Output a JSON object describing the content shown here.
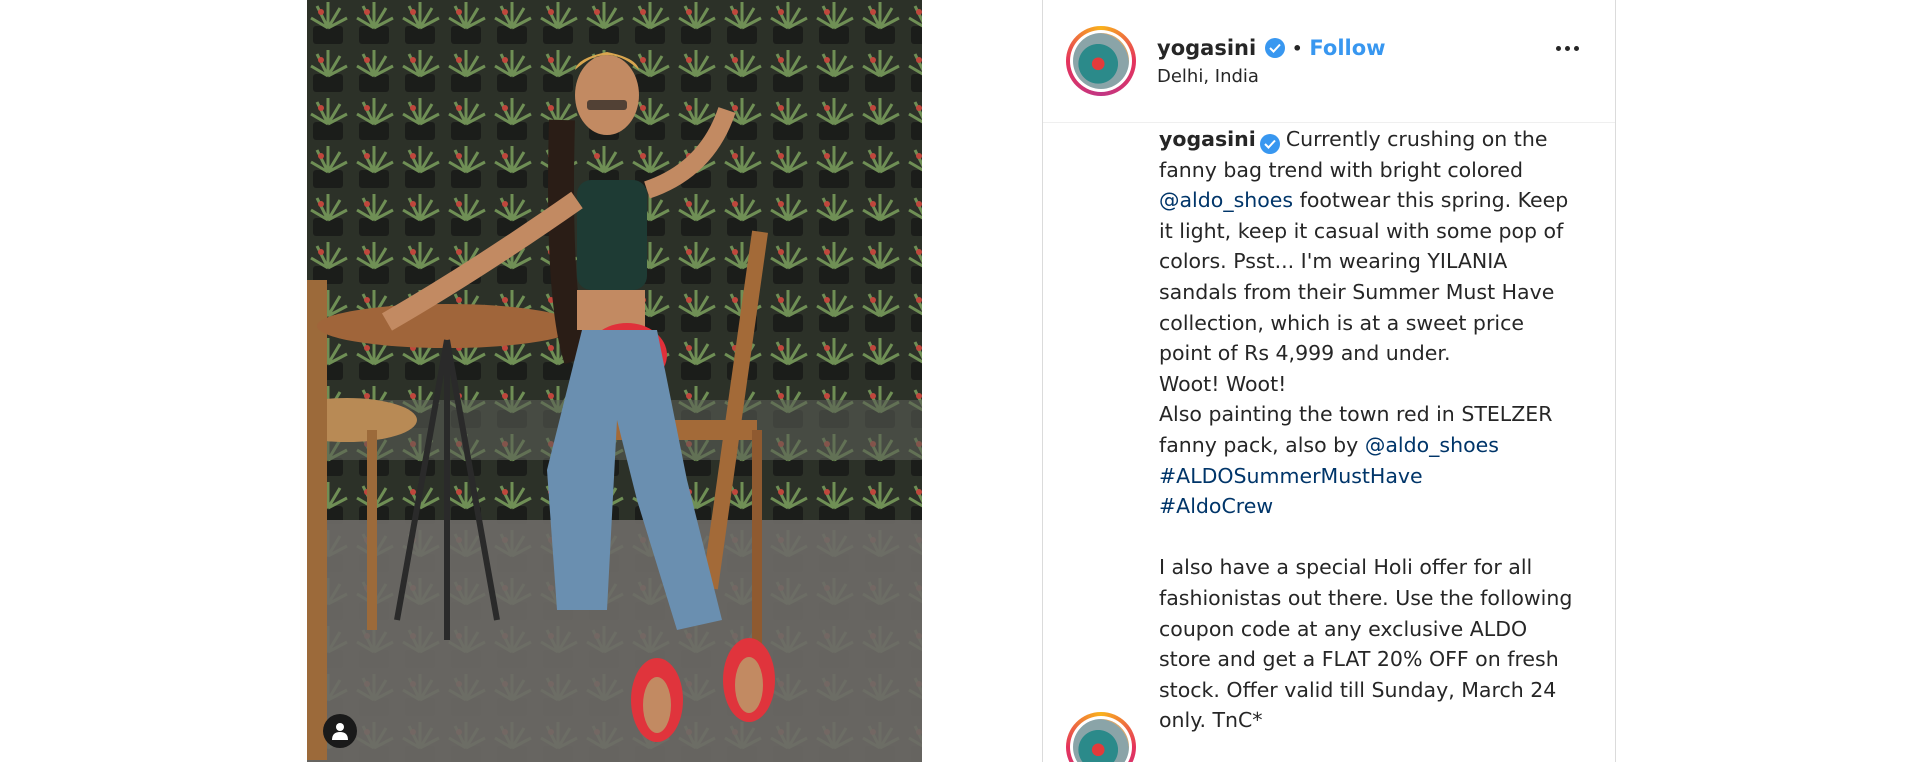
{
  "post": {
    "username": "yogasini",
    "follow_label": "Follow",
    "separator": "•",
    "location": "Delhi, India",
    "photo_alt": "Post photo"
  },
  "caption": {
    "username": "yogasini",
    "text_1": "Currently crushing on the fanny bag trend with bright colored",
    "mention_1": "@aldo_shoes",
    "text_2": "footwear this spring. Keep it light, keep it casual with some pop of colors. Psst... I'm wearing YILANIA sandals from their Summer Must Have collection, which is at a sweet price point of Rs 4,999 and under.",
    "line_woot": "Woot! Woot!",
    "text_3": "Also painting the town red in STELZER fanny pack, also by",
    "mention_2": "@aldo_shoes",
    "hashtag_1": "#ALDOSummerMustHave",
    "hashtag_2": "#AldoCrew",
    "text_4": "I also have a special Holi offer for all fashionistas out there. Use the following coupon code at any exclusive ALDO store and get a FLAT 20% OFF on fresh stock. Offer valid till Sunday, March 24 only. TnC*"
  },
  "colors": {
    "accent": "#3897f0",
    "link": "#003569",
    "text": "#262626"
  },
  "icons": {
    "verified": "verified-badge-icon",
    "more": "more-options-icon",
    "tagged_user": "user-tag-icon"
  }
}
